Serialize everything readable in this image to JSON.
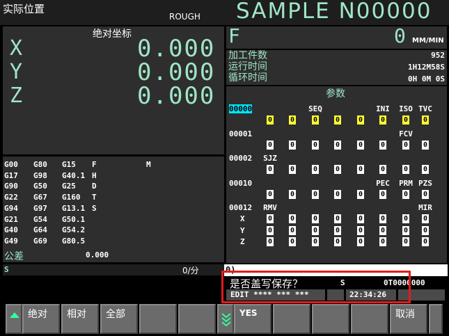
{
  "header": {
    "screen_title": "实际位置",
    "mode": "ROUGH",
    "program": "SAMPLE N00000"
  },
  "position": {
    "title": "绝对坐标",
    "axes": [
      {
        "name": "X",
        "value": "0.000"
      },
      {
        "name": "Y",
        "value": "0.000"
      },
      {
        "name": "Z",
        "value": "0.000"
      }
    ]
  },
  "feed": {
    "label": "F",
    "value": "0",
    "unit": "MM/MIN"
  },
  "counters": [
    {
      "label": "加工件数",
      "value": "952"
    },
    {
      "label": "运行时间",
      "value": "1H12M58S"
    },
    {
      "label": "循环时间",
      "value": "0H 0M 0S"
    }
  ],
  "gcodes": {
    "rows": [
      [
        "G00",
        "G80",
        "G15",
        "F",
        "M"
      ],
      [
        "G17",
        "G98",
        "G40.1",
        "H",
        ""
      ],
      [
        "G90",
        "G50",
        "G25",
        "D",
        ""
      ],
      [
        "G22",
        "G67",
        "G160",
        "T",
        ""
      ],
      [
        "G94",
        "G97",
        "G13.1",
        "S",
        ""
      ],
      [
        "G21",
        "G54",
        "G50.1",
        "",
        ""
      ],
      [
        "G40",
        "G64",
        "G54.2",
        "",
        ""
      ],
      [
        "G49",
        "G69",
        "G80.5",
        "",
        ""
      ]
    ],
    "tolerance_label": "公差",
    "tolerance_value": "0.000"
  },
  "spindle": {
    "label": "S",
    "value": "0/分"
  },
  "params": {
    "title": "参数",
    "groups": [
      {
        "number": "00000",
        "selected": true,
        "names": [
          "",
          "",
          "SEQ",
          "",
          "",
          "INI",
          "ISO",
          "TVC"
        ],
        "rows": [
          {
            "axis": "",
            "bits": [
              "0",
              "0",
              "0",
              "0",
              "0",
              "0",
              "0",
              "0"
            ],
            "highlight": [
              true,
              true,
              true,
              true,
              true,
              true,
              true,
              true
            ]
          }
        ]
      },
      {
        "number": "00001",
        "selected": false,
        "names": [
          "",
          "",
          "",
          "",
          "",
          "",
          "FCV",
          ""
        ],
        "rows": [
          {
            "axis": "",
            "bits": [
              "0",
              "0",
              "0",
              "0",
              "0",
              "0",
              "0",
              "0"
            ],
            "highlight": [
              false,
              false,
              false,
              false,
              false,
              false,
              false,
              false
            ]
          }
        ]
      },
      {
        "number": "00002",
        "selected": false,
        "names": [
          "SJZ",
          "",
          "",
          "",
          "",
          "",
          "",
          ""
        ],
        "rows": [
          {
            "axis": "",
            "bits": [
              "0",
              "0",
              "0",
              "0",
              "0",
              "0",
              "0",
              "0"
            ],
            "highlight": [
              false,
              false,
              false,
              false,
              false,
              false,
              false,
              false
            ]
          }
        ]
      },
      {
        "number": "00010",
        "selected": false,
        "names": [
          "",
          "",
          "",
          "",
          "",
          "PEC",
          "PRM",
          "PZS"
        ],
        "rows": [
          {
            "axis": "",
            "bits": [
              "0",
              "0",
              "0",
              "0",
              "0",
              "0",
              "0",
              "0"
            ],
            "highlight": [
              false,
              false,
              false,
              false,
              false,
              false,
              false,
              false
            ]
          }
        ]
      },
      {
        "number": "00012",
        "selected": false,
        "names": [
          "RMV",
          "",
          "",
          "",
          "",
          "",
          "",
          "MIR"
        ],
        "rows": [
          {
            "axis": "X",
            "bits": [
              "0",
              "0",
              "0",
              "0",
              "0",
              "0",
              "0",
              "0"
            ],
            "highlight": [
              false,
              false,
              false,
              false,
              false,
              false,
              false,
              false
            ]
          },
          {
            "axis": "Y",
            "bits": [
              "0",
              "0",
              "0",
              "0",
              "0",
              "0",
              "0",
              "0"
            ],
            "highlight": [
              false,
              false,
              false,
              false,
              false,
              false,
              false,
              false
            ]
          },
          {
            "axis": "Z",
            "bits": [
              "0",
              "0",
              "0",
              "0",
              "0",
              "0",
              "0",
              "0"
            ],
            "highlight": [
              false,
              false,
              false,
              false,
              false,
              false,
              false,
              false
            ]
          }
        ]
      }
    ]
  },
  "input_prompt": "0)",
  "message": "是否盖写保存？",
  "status": {
    "s_label": "S",
    "tool": "0T0000000",
    "mode_line": "EDIT **** *** ***",
    "clock": "22:34:26"
  },
  "softkeys": {
    "absolute": "绝对",
    "relative": "相对",
    "all": "全部",
    "yes": "YES",
    "cancel": "取消"
  },
  "colors": {
    "accent_mint": "#9fe6c6",
    "highlight_yellow": "#ffff33",
    "selected_cyan": "#00e5ff",
    "annotation_red": "#e41b1b"
  }
}
